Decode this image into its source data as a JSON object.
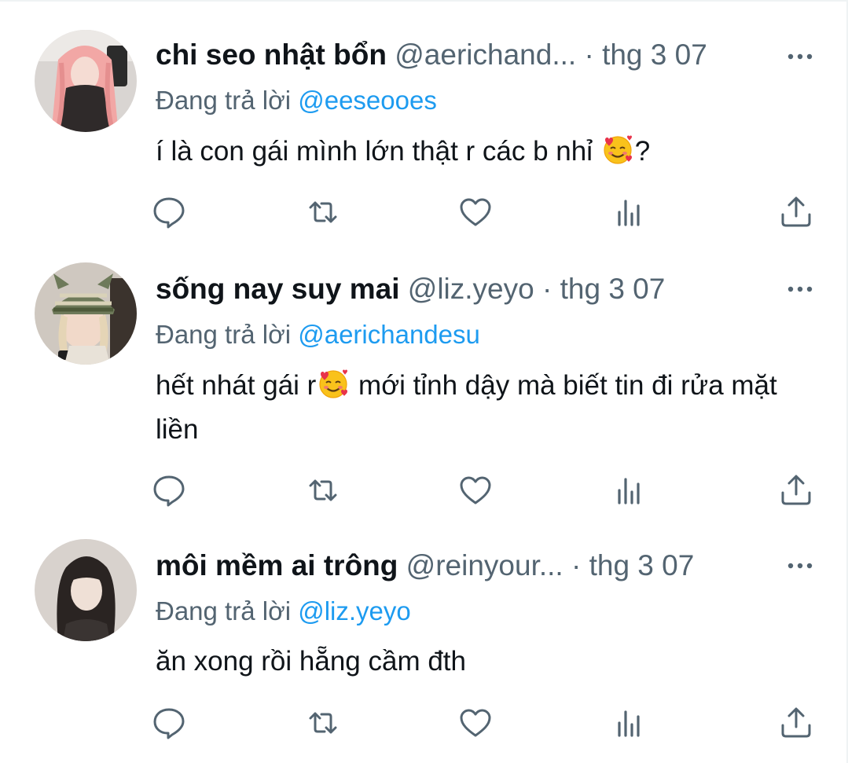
{
  "tweets": [
    {
      "display_name": "chi seo nhật bổn",
      "handle": "@aerichand...",
      "separator": "·",
      "date": "thg 3 07",
      "reply_prefix": "Đang trả lời",
      "reply_to": "@eeseooes",
      "text_before_emoji": "í là con gái mình lớn thật r các b nhỉ ",
      "text_after_emoji": "?",
      "emoji": "smiling-face-with-hearts",
      "avatar": "pink-hair-avatar"
    },
    {
      "display_name": "sống nay suy mai",
      "handle": "@liz.yeyo",
      "separator": "·",
      "date": "thg 3 07",
      "reply_prefix": "Đang trả lời",
      "reply_to": "@aerichandesu",
      "text_before_emoji": "hết nhát gái r",
      "text_after_emoji": " mới tỉnh dậy mà biết tin đi rửa mặt liền",
      "emoji": "smiling-face-with-hearts",
      "avatar": "striped-beanie-avatar"
    },
    {
      "display_name": "môi mềm ai trông",
      "handle": "@reinyour...",
      "separator": "·",
      "date": "thg 3 07",
      "reply_prefix": "Đang trả lời",
      "reply_to": "@liz.yeyo",
      "text_before_emoji": "ăn xong rồi hẵng cầm đth",
      "text_after_emoji": "",
      "emoji": "",
      "avatar": "dark-hair-avatar"
    }
  ],
  "action_icons": [
    "reply-icon",
    "retweet-icon",
    "like-icon",
    "views-icon",
    "share-icon"
  ],
  "colors": {
    "text": "#0f1419",
    "secondary": "#536471",
    "mention": "#1d9bf0",
    "divider": "#eff3f4"
  }
}
